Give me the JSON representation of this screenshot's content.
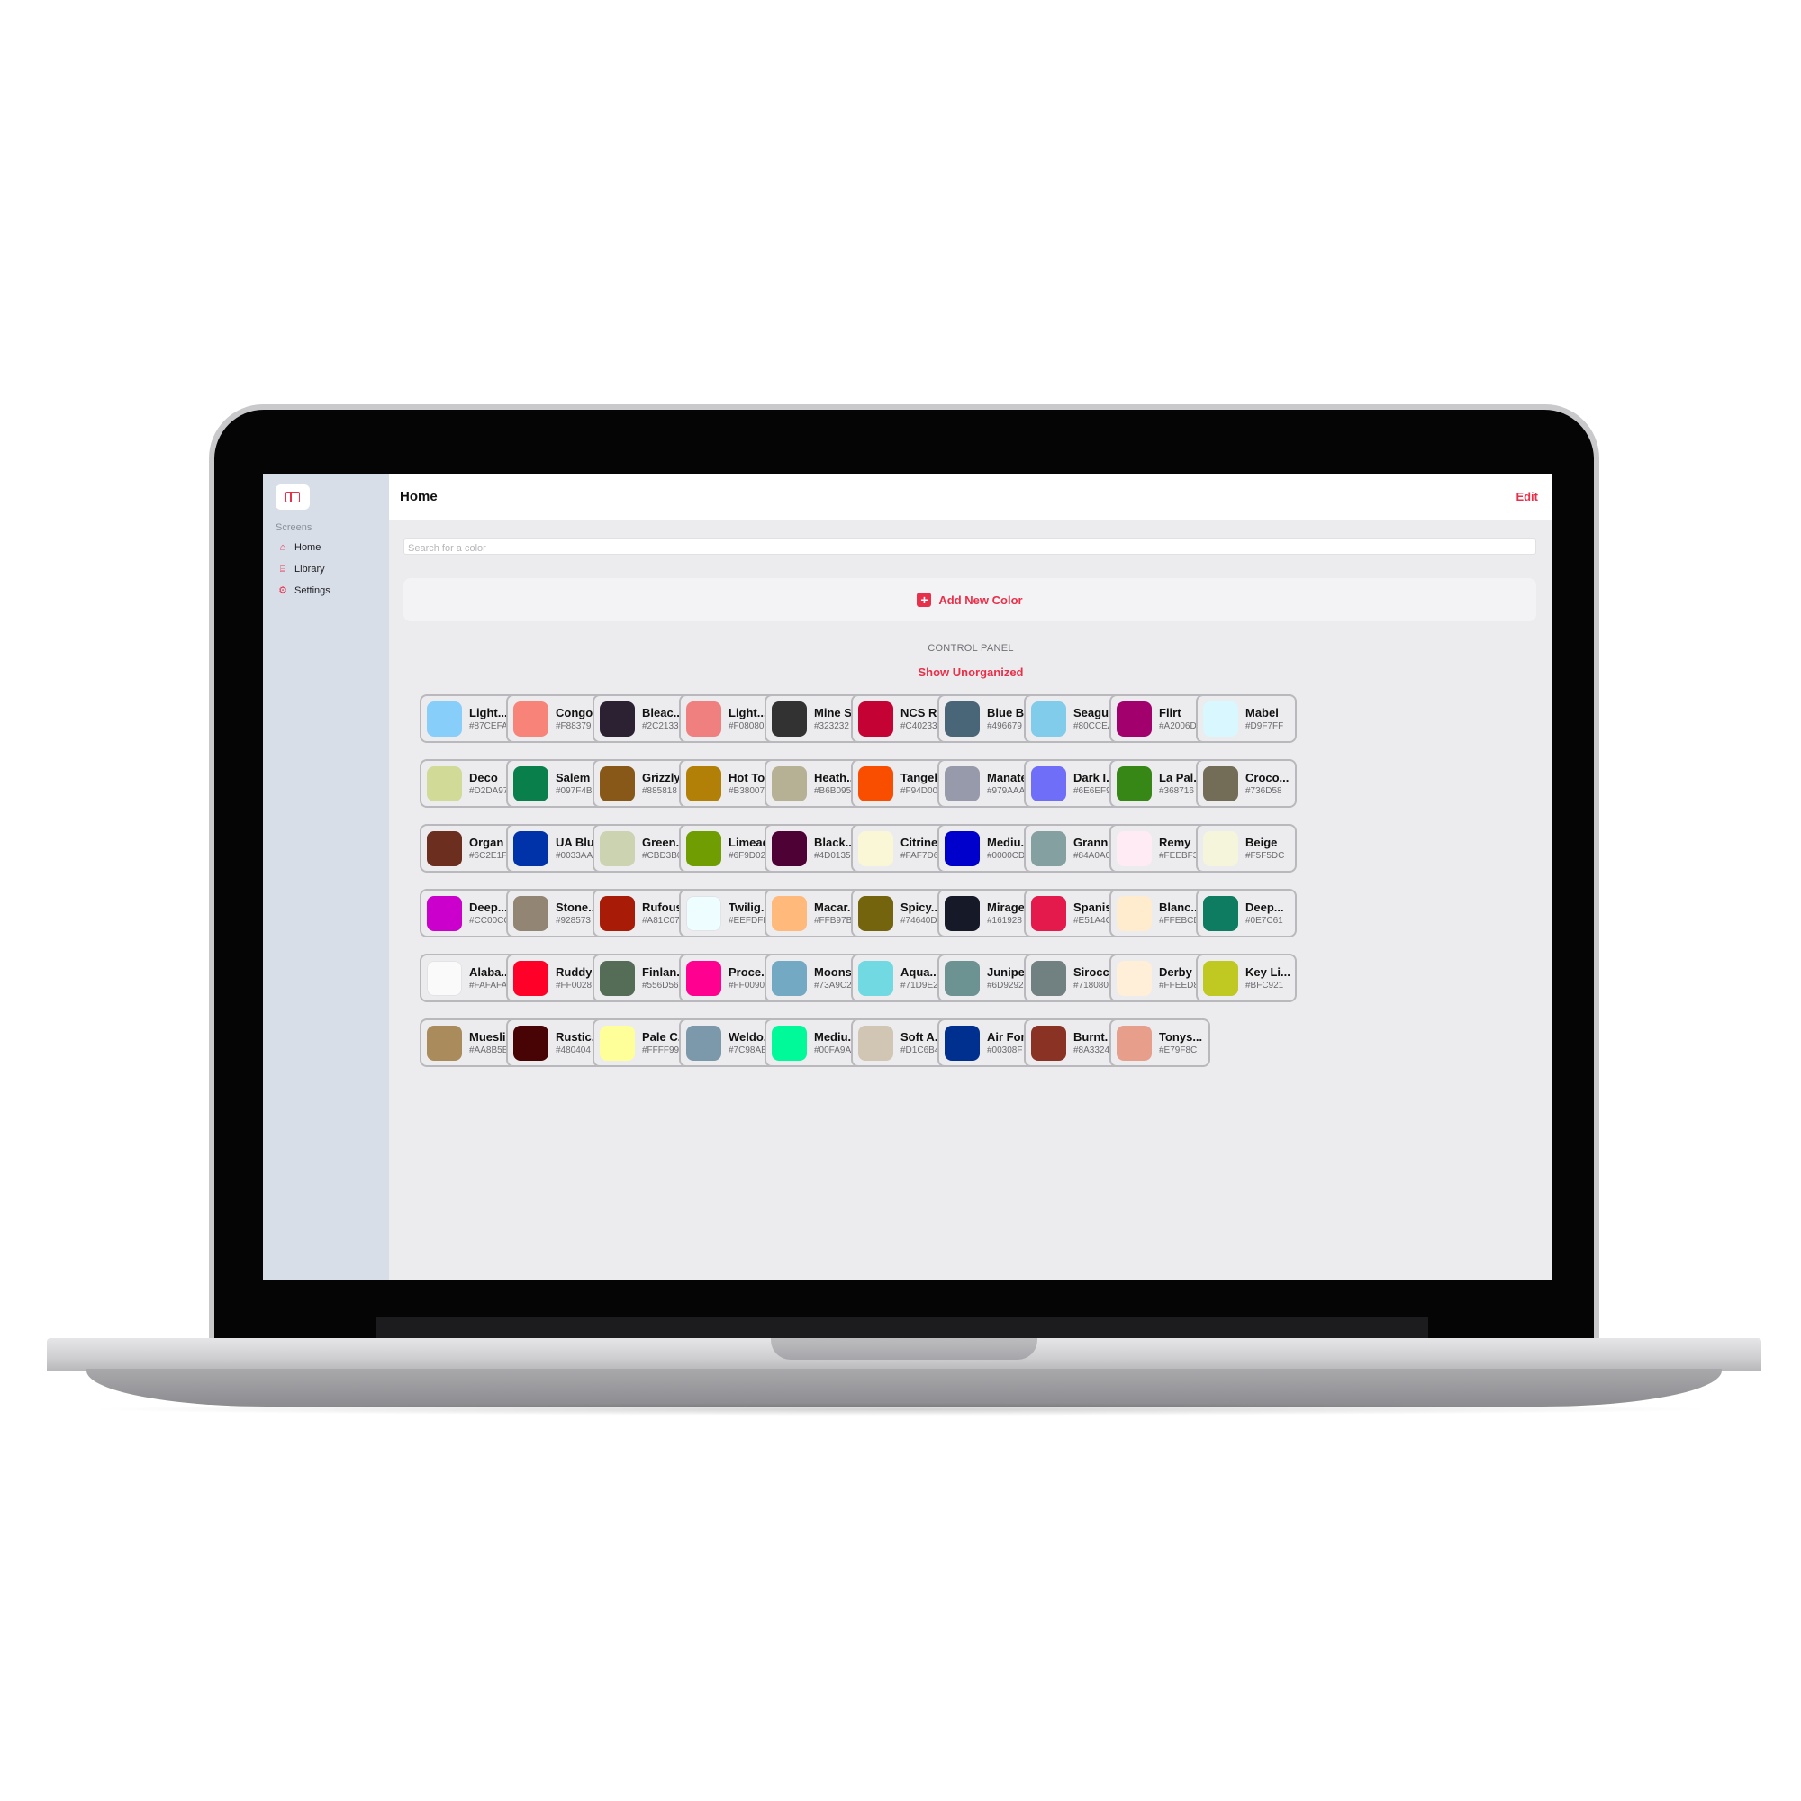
{
  "sidebar": {
    "section": "Screens",
    "items": [
      {
        "label": "Home",
        "icon": "house-icon"
      },
      {
        "label": "Library",
        "icon": "building-columns-icon"
      },
      {
        "label": "Settings",
        "icon": "gear-icon"
      }
    ]
  },
  "header": {
    "title": "Home",
    "edit_label": "Edit"
  },
  "search": {
    "placeholder": "Search for a color",
    "value": ""
  },
  "add_color_label": "Add New Color",
  "control_panel": {
    "label": "CONTROL PANEL",
    "show_unorganized": "Show Unorganized"
  },
  "accent": "#E8304A",
  "colors": [
    {
      "name": "Light...",
      "hex": "#87CEFA"
    },
    {
      "name": "Congo...",
      "hex": "#F88379"
    },
    {
      "name": "Bleac...",
      "hex": "#2C2133"
    },
    {
      "name": "Light...",
      "hex": "#F08080"
    },
    {
      "name": "Mine S...",
      "hex": "#323232"
    },
    {
      "name": "NCS R...",
      "hex": "#C40233"
    },
    {
      "name": "Blue B...",
      "hex": "#496679"
    },
    {
      "name": "Seagull",
      "hex": "#80CCEA"
    },
    {
      "name": "Flirt",
      "hex": "#A2006D"
    },
    {
      "name": "Mabel",
      "hex": "#D9F7FF"
    },
    {
      "name": "Deco",
      "hex": "#D2DA97"
    },
    {
      "name": "Salem",
      "hex": "#097F4B"
    },
    {
      "name": "Grizzly",
      "hex": "#885818"
    },
    {
      "name": "Hot To...",
      "hex": "#B38007"
    },
    {
      "name": "Heath...",
      "hex": "#B6B095"
    },
    {
      "name": "Tangelo",
      "hex": "#F94D00"
    },
    {
      "name": "Manatee",
      "hex": "#979AAA"
    },
    {
      "name": "Dark I...",
      "hex": "#6E6EF9"
    },
    {
      "name": "La Pal...",
      "hex": "#368716"
    },
    {
      "name": "Croco...",
      "hex": "#736D58"
    },
    {
      "name": "Organ",
      "hex": "#6C2E1F"
    },
    {
      "name": "UA Blue",
      "hex": "#0033AA"
    },
    {
      "name": "Green...",
      "hex": "#CBD3B0"
    },
    {
      "name": "Limeade",
      "hex": "#6F9D02"
    },
    {
      "name": "Black...",
      "hex": "#4D0135"
    },
    {
      "name": "Citrine...",
      "hex": "#FAF7D6"
    },
    {
      "name": "Mediu...",
      "hex": "#0000CD"
    },
    {
      "name": "Grann...",
      "hex": "#84A0A0"
    },
    {
      "name": "Remy",
      "hex": "#FEEBF3"
    },
    {
      "name": "Beige",
      "hex": "#F5F5DC"
    },
    {
      "name": "Deep...",
      "hex": "#CC00CC"
    },
    {
      "name": "Stone...",
      "hex": "#928573"
    },
    {
      "name": "Rufous",
      "hex": "#A81C07"
    },
    {
      "name": "Twilig...",
      "hex": "#EEFDFF"
    },
    {
      "name": "Macar...",
      "hex": "#FFB97B"
    },
    {
      "name": "Spicy...",
      "hex": "#74640D"
    },
    {
      "name": "Mirage",
      "hex": "#161928"
    },
    {
      "name": "Spanis...",
      "hex": "#E51A4C"
    },
    {
      "name": "Blanc...",
      "hex": "#FFEBCD"
    },
    {
      "name": "Deep...",
      "hex": "#0E7C61"
    },
    {
      "name": "Alaba...",
      "hex": "#FAFAFA"
    },
    {
      "name": "Ruddy",
      "hex": "#FF0028"
    },
    {
      "name": "Finlan...",
      "hex": "#556D56"
    },
    {
      "name": "Proce...",
      "hex": "#FF0090"
    },
    {
      "name": "Moons...",
      "hex": "#73A9C2"
    },
    {
      "name": "Aqua...",
      "hex": "#71D9E2"
    },
    {
      "name": "Juniper",
      "hex": "#6D9292"
    },
    {
      "name": "Sirocco",
      "hex": "#718080"
    },
    {
      "name": "Derby",
      "hex": "#FFEED8"
    },
    {
      "name": "Key Li...",
      "hex": "#BFC921"
    },
    {
      "name": "Muesli",
      "hex": "#AA8B5B"
    },
    {
      "name": "Rustic...",
      "hex": "#480404"
    },
    {
      "name": "Pale C...",
      "hex": "#FFFF99"
    },
    {
      "name": "Weldo...",
      "hex": "#7C98AB"
    },
    {
      "name": "Mediu...",
      "hex": "#00FA9A"
    },
    {
      "name": "Soft A...",
      "hex": "#D1C6B4"
    },
    {
      "name": "Air For...",
      "hex": "#00308F"
    },
    {
      "name": "Burnt...",
      "hex": "#8A3324"
    },
    {
      "name": "Tonys...",
      "hex": "#E79F8C"
    }
  ]
}
